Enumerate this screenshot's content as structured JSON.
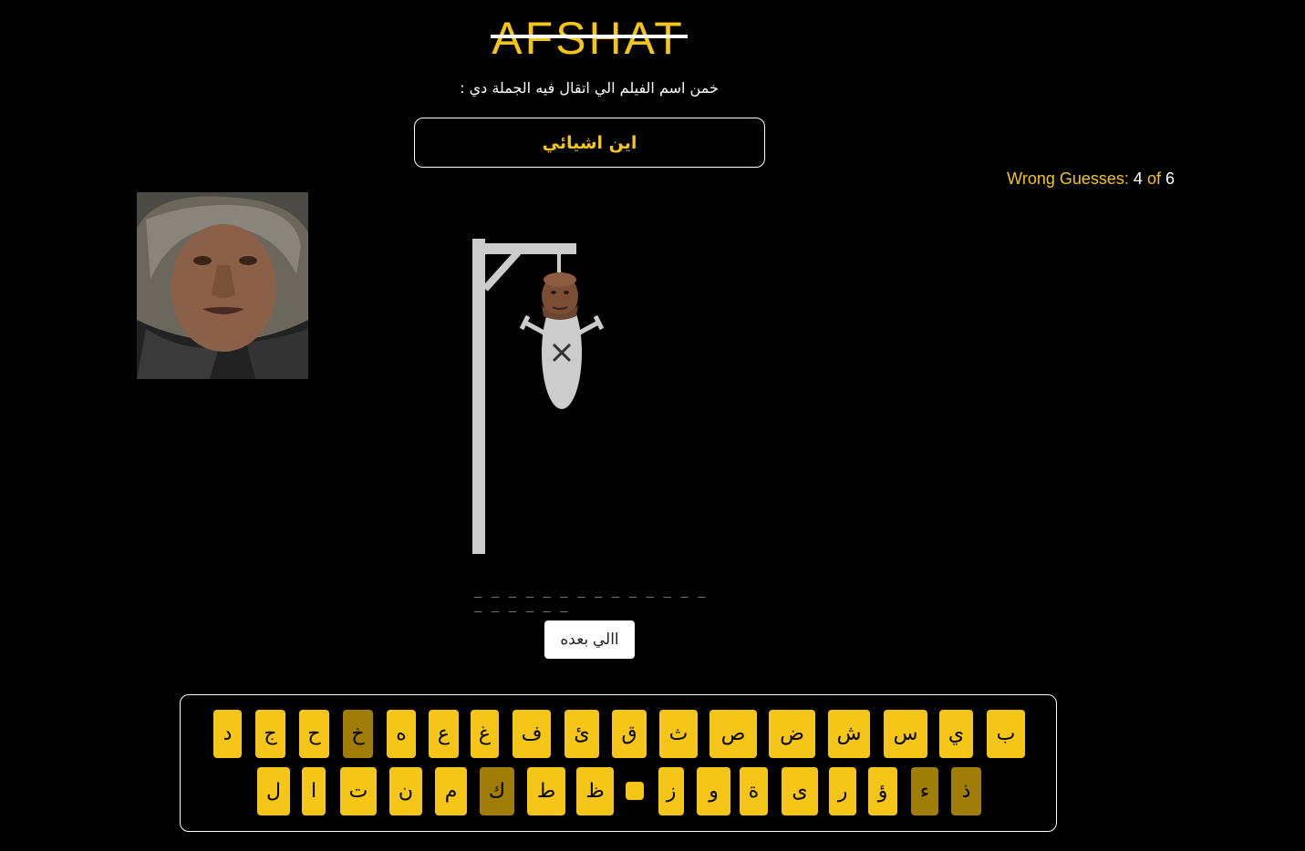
{
  "header": {
    "logo_text": "AFSHAT",
    "instruction": "خمن اسم الفيلم الي اتقال فيه الجملة دي :",
    "quote": "اين اشيائي"
  },
  "status": {
    "label": "Wrong Guesses:",
    "count": "4",
    "of_label": "of",
    "max": "6"
  },
  "hangman": {
    "wrong_guesses": 4,
    "max_wrong": 6
  },
  "word": {
    "dashes": "_ _ _ _ _ _ _ _ _ _ _ _ _ _ _ _ _ _ _ _"
  },
  "actions": {
    "next_label": "االي بعده"
  },
  "keyboard": {
    "row1": [
      {
        "letter": "د",
        "used": false
      },
      {
        "letter": "ج",
        "used": false
      },
      {
        "letter": "ح",
        "used": false
      },
      {
        "letter": "خ",
        "used": true
      },
      {
        "letter": "ه",
        "used": false
      },
      {
        "letter": "ع",
        "used": false
      },
      {
        "letter": "غ",
        "used": false
      },
      {
        "letter": "ف",
        "used": false
      },
      {
        "letter": "ئ",
        "used": false
      },
      {
        "letter": "ق",
        "used": false
      },
      {
        "letter": "ث",
        "used": false
      },
      {
        "letter": "ص",
        "used": false
      },
      {
        "letter": "ض",
        "used": false
      },
      {
        "letter": "ش",
        "used": false
      },
      {
        "letter": "س",
        "used": false
      },
      {
        "letter": "ي",
        "used": false
      },
      {
        "letter": "ب",
        "used": false
      }
    ],
    "row2": [
      {
        "letter": "ل",
        "used": false
      },
      {
        "letter": "ا",
        "used": false
      },
      {
        "letter": "ت",
        "used": false
      },
      {
        "letter": "ن",
        "used": false
      },
      {
        "letter": "م",
        "used": false
      },
      {
        "letter": "ك",
        "used": true
      },
      {
        "letter": "ط",
        "used": false
      },
      {
        "letter": "ظ",
        "used": false
      },
      {
        "letter": "",
        "used": false
      },
      {
        "letter": "ز",
        "used": false
      },
      {
        "letter": "و",
        "used": false
      },
      {
        "letter": "ة",
        "used": false
      },
      {
        "letter": "ى",
        "used": false
      },
      {
        "letter": "ر",
        "used": false
      },
      {
        "letter": "ؤ",
        "used": false
      },
      {
        "letter": "ء",
        "used": true
      },
      {
        "letter": "ذ",
        "used": true
      }
    ]
  },
  "colors": {
    "accent": "#f5c518",
    "key_used": "#a07d07",
    "background": "#000000"
  }
}
